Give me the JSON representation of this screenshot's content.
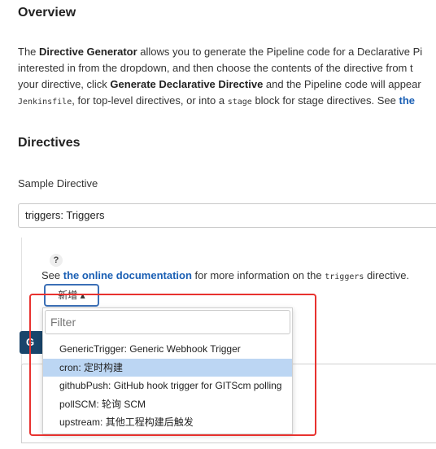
{
  "overview": {
    "heading": "Overview",
    "line1_pre": "The ",
    "line1_bold": "Directive Generator",
    "line1_post": " allows you to generate the Pipeline code for a Declarative Pi",
    "line2": "interested in from the dropdown, and then choose the contents of the directive from t",
    "line3_pre": "your directive, click ",
    "line3_bold": "Generate Declarative Directive",
    "line3_post": " and the Pipeline code will appear",
    "line4_code1": "Jenkinsfile",
    "line4_mid": ", for top-level directives, or into a ",
    "line4_code2": "stage",
    "line4_post": " block for stage directives. See ",
    "line4_link": "the"
  },
  "directives": {
    "heading": "Directives",
    "sample_label": "Sample Directive",
    "sample_value": "triggers: Triggers"
  },
  "help": {
    "icon": "?",
    "see": "See ",
    "doc_link": "the online documentation",
    "mid": " for more information on the ",
    "code": "triggers",
    "post": " directive."
  },
  "add_button": {
    "label": "新增 ▴"
  },
  "generate_button": {
    "label": "G"
  },
  "dropdown": {
    "filter_placeholder": "Filter",
    "items": [
      {
        "label": "GenericTrigger: Generic Webhook Trigger"
      },
      {
        "label": "cron: 定时构建"
      },
      {
        "label": "githubPush: GitHub hook trigger for GITScm polling"
      },
      {
        "label": "pollSCM: 轮询 SCM"
      },
      {
        "label": "upstream: 其他工程构建后触发"
      }
    ],
    "selected_index": 1
  },
  "colors": {
    "link": "#1a5fb4",
    "highlight_border": "#e8322f",
    "selected_item": "#bcd6f3",
    "primary_button": "#19456b"
  }
}
